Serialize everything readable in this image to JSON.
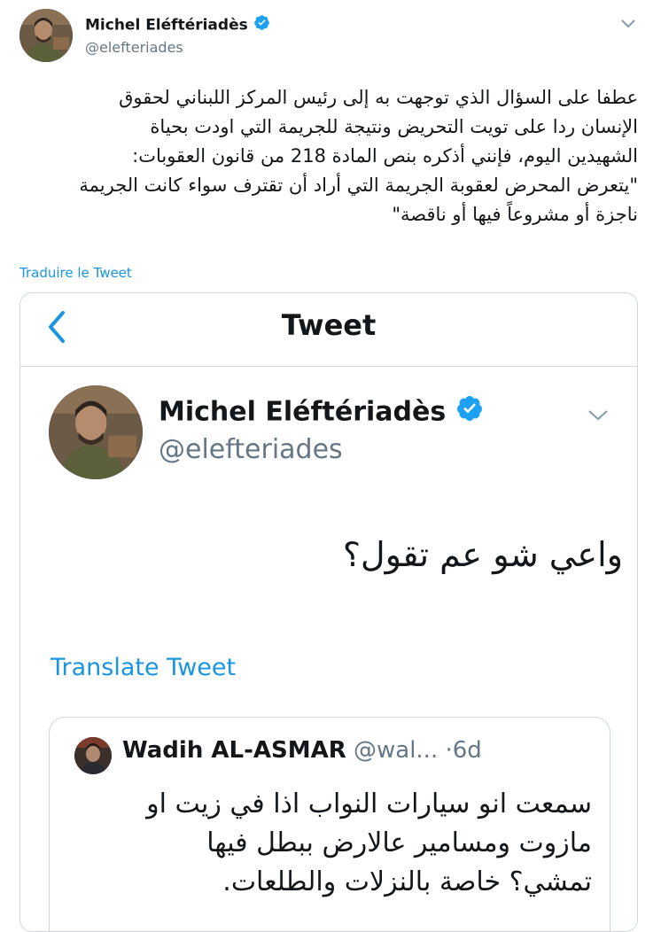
{
  "tweet": {
    "author_name": "Michel Eléftériadès",
    "author_handle": "@elefteriades",
    "body_lines": [
      "عطفا على السؤال الذي توجهت به إلى رئيس المركز اللبناني لحقوق",
      "الإنسان ردا على تويت التحريض ونتيجة للجريمة التي اودت بحياة",
      "الشهيدين اليوم، فإنني أذكره بنص المادة 218 من قانون العقوبات:",
      "\"يتعرض المحرض لعقوبة الجريمة التي أراد أن تقترف سواء كانت الجريمة",
      "ناجزة أو مشروعاً فيها أو ناقصة\""
    ],
    "translate_label": "Traduire le Tweet",
    "verified_icon": "verified-badge-icon",
    "menu_icon": "chevron-down-icon",
    "accent_color": "#1b95e0"
  },
  "screenshot": {
    "header_title": "Tweet",
    "back_icon": "chevron-left-icon",
    "author_name": "Michel Eléftériadès",
    "author_handle": "@elefteriades",
    "body": "واعي شو عم تقول؟",
    "translate_label": "Translate Tweet",
    "quoted": {
      "author_name": "Wadih AL-ASMAR",
      "author_handle": "@wal...",
      "separator": "·",
      "age": "6d",
      "body_lines": [
        "سمعت انو سيارات النواب اذا في زيت او",
        "مازوت ومسامير عالارض ببطل فيها",
        "تمشي؟ خاصة بالنزلات والطلعات."
      ]
    }
  }
}
